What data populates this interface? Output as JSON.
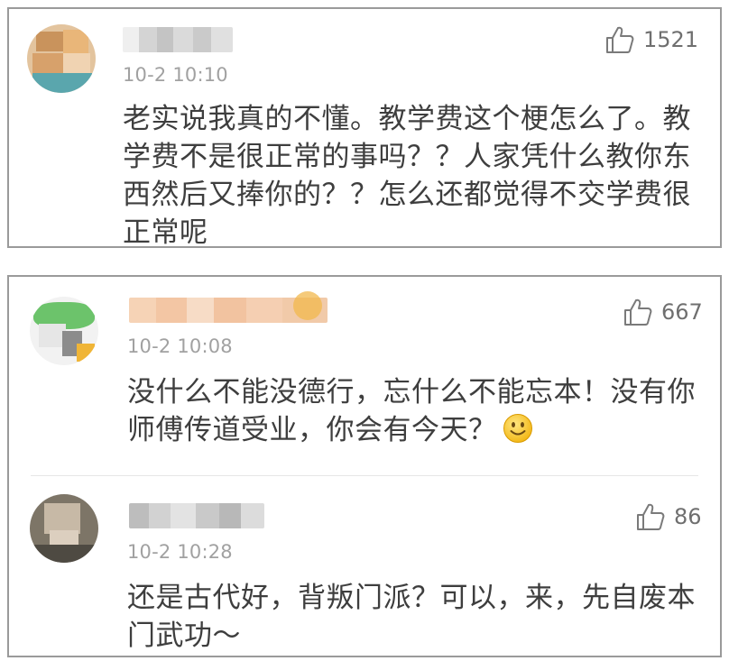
{
  "comments": [
    {
      "username": "",
      "time": "10-2 10:10",
      "likes": "1521",
      "text": "老实说我真的不懂。教学费这个梗怎么了。教学费不是很正常的事吗？？人家凭什么教你东西然后又捧你的？？怎么还都觉得不交学费很正常呢"
    },
    {
      "username": "",
      "time": "10-2 10:08",
      "likes": "667",
      "text": "没什么不能没德行，忘什么不能忘本！没有你师傅传道受业，你会有今天？"
    },
    {
      "username": "",
      "time": "10-2 10:28",
      "likes": "86",
      "text": "还是古代好，背叛门派？可以，来，先自废本门武功～"
    }
  ],
  "colors": {
    "border": "#9a9a9a",
    "text": "#3e3e3e",
    "meta": "#a1a1a1",
    "count": "#6f6f6f"
  },
  "icons": {
    "like": "thumbs-up-icon",
    "emoji": "smiling-face-icon"
  }
}
